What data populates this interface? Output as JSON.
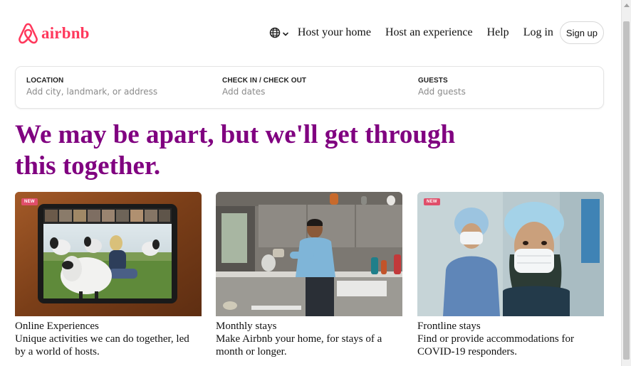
{
  "brand": {
    "name": "airbnb",
    "logo_icon": "airbnb-belo-icon",
    "color": "#ff385c"
  },
  "nav": {
    "language_icon": "globe-icon",
    "items": [
      {
        "label": "Host your home"
      },
      {
        "label": "Host an experience"
      },
      {
        "label": "Help"
      },
      {
        "label": "Log in"
      }
    ],
    "signup_label": "Sign up"
  },
  "search": {
    "location": {
      "label": "LOCATION",
      "placeholder": "Add city, landmark, or address"
    },
    "dates": {
      "label": "CHECK IN / CHECK OUT",
      "placeholder": "Add dates"
    },
    "guests": {
      "label": "GUESTS",
      "placeholder": "Add guests"
    }
  },
  "hero": {
    "headline": "We may be apart, but we'll get through this together.",
    "color": "#800080"
  },
  "cards": [
    {
      "badge": "NEW",
      "title": "Online Experiences",
      "description": "Unique activities we can do together, led by a world of hosts."
    },
    {
      "badge": "",
      "title": "Monthly stays",
      "description": "Make Airbnb your home, for stays of a month or longer."
    },
    {
      "badge": "NEW",
      "title": "Frontline stays",
      "description": "Find or provide accommodations for COVID-19 responders."
    }
  ]
}
